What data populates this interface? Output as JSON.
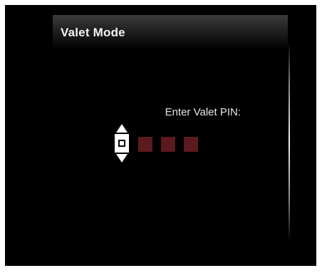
{
  "header": {
    "title": "Valet Mode"
  },
  "pin": {
    "prompt": "Enter Valet PIN:",
    "total_digits": 4,
    "active_digit": 1,
    "slot_color": "#5a1a1e"
  },
  "colors": {
    "background": "#000000",
    "text": "#e6e6e6",
    "active": "#ffffff"
  }
}
